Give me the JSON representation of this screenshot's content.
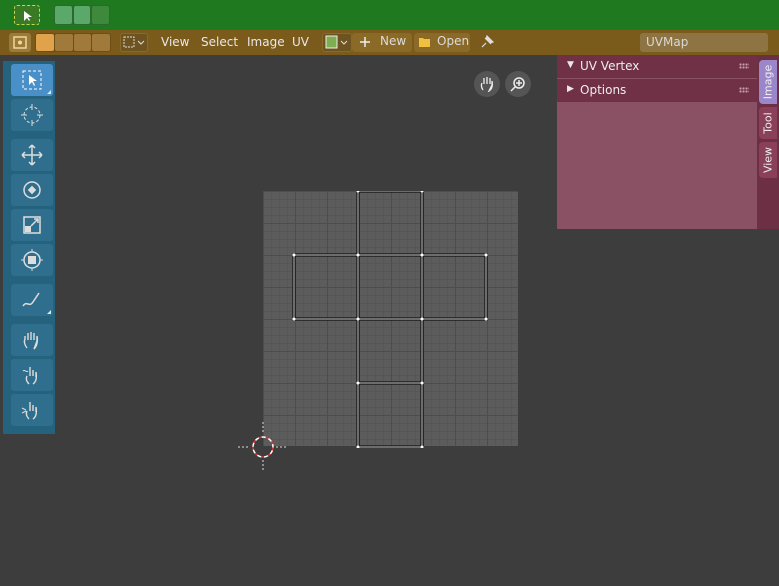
{
  "topbar": {
    "select_mode_icon": "cursor-select-icon",
    "sync_modes": [
      {
        "icon": "sync-vertex-icon",
        "active": true
      },
      {
        "icon": "sync-edge-icon",
        "active": true
      },
      {
        "icon": "sync-face-icon",
        "active": false
      }
    ]
  },
  "header": {
    "editor_type_icon": "uv-editor-icon",
    "pivot_modes": [
      "pivot-bounding-box-icon",
      "pivot-median-icon",
      "pivot-cursor-icon",
      "pivot-individual-icon"
    ],
    "snap_icon": "snap-select-icon",
    "menus": [
      "View",
      "Select",
      "Image",
      "UV"
    ],
    "image_browse_icon": "image-browse-icon",
    "new_label": "New",
    "open_label": "Open",
    "pin_icon": "pin-icon",
    "uv_map": "UVMap"
  },
  "toolbar": {
    "tools": [
      {
        "name": "select-box-tool",
        "icon": "select-box-icon",
        "active": true
      },
      {
        "name": "cursor-tool",
        "icon": "cursor-icon",
        "active": false
      },
      {
        "name": "move-tool",
        "icon": "move-icon",
        "active": false
      },
      {
        "name": "rotate-tool",
        "icon": "rotate-icon",
        "active": false
      },
      {
        "name": "scale-tool",
        "icon": "scale-icon",
        "active": false
      },
      {
        "name": "transform-tool",
        "icon": "transform-icon",
        "active": false
      },
      {
        "name": "annotate-tool",
        "icon": "annotate-icon",
        "active": false
      },
      {
        "name": "grab-tool",
        "icon": "grab-icon",
        "active": false
      },
      {
        "name": "relax-tool",
        "icon": "relax-icon",
        "active": false
      },
      {
        "name": "pinch-tool",
        "icon": "pinch-icon",
        "active": false
      }
    ]
  },
  "navigation": {
    "pan_icon": "hand-pan-icon",
    "zoom_icon": "zoom-icon"
  },
  "sidebar": {
    "panels": [
      {
        "label": "UV Vertex",
        "expanded": true
      },
      {
        "label": "Options",
        "expanded": false
      }
    ],
    "tabs": [
      {
        "label": "Image",
        "active": true
      },
      {
        "label": "Tool",
        "active": false
      },
      {
        "label": "View",
        "active": false
      }
    ]
  },
  "colors": {
    "topbar": "#1f7a1f",
    "header": "#7b5b1c",
    "toolbar": "#25627d",
    "sidebar": "#8a5064",
    "tabs": "#6d2f44",
    "viewport": "#3d3d3d"
  }
}
